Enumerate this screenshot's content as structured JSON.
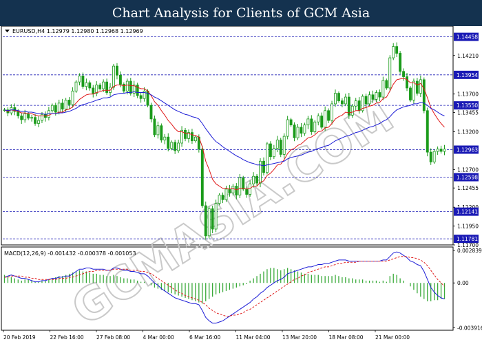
{
  "banner": {
    "title": "Chart Analysis for Clients of GCM Asia"
  },
  "watermark": "GCMASIA.COM",
  "colors": {
    "banner_bg": "#14324f",
    "candle": "#1a9b1a",
    "ma_fast": "#e01919",
    "ma_slow": "#1c1cd6",
    "level_line": "#1a1ab5",
    "level_box": "#1a1ab5",
    "macd_hist": "#3aaa3a",
    "macd_signal": "#e02020",
    "macd_line": "#1c1cd6"
  },
  "chart_data": [
    {
      "type": "candlestick",
      "header": "EURUSD,H4  1.12979 1.12980 1.12968 1.12969",
      "ylim": [
        1.117,
        1.146
      ],
      "yticks": [
        "1.14458",
        "1.14210",
        "1.13954",
        "1.13700",
        "1.13550",
        "1.13455",
        "1.13200",
        "1.12963",
        "1.12700",
        "1.12598",
        "1.12455",
        "1.12200",
        "1.12141",
        "1.11950",
        "1.11781",
        "1.11700"
      ],
      "levels": [
        {
          "value": 1.14458,
          "label": "1.14458"
        },
        {
          "value": 1.13954,
          "label": "1.13954"
        },
        {
          "value": 1.1355,
          "label": "1.13550"
        },
        {
          "value": 1.12963,
          "label": "1.12963"
        },
        {
          "value": 1.12598,
          "label": "1.12598"
        },
        {
          "value": 1.12141,
          "label": "1.12141"
        },
        {
          "value": 1.11781,
          "label": "1.11781"
        }
      ],
      "xticks": [
        "20 Feb 2019",
        "22 Feb 16:00",
        "27 Feb 08:00",
        "4 Mar 00:00",
        "6 Mar 16:00",
        "11 Mar 04:00",
        "13 Mar 20:00",
        "18 Mar 08:00",
        "21 Mar 00:00"
      ],
      "close": [
        1.1349,
        1.1345,
        1.1352,
        1.1347,
        1.1341,
        1.1336,
        1.1344,
        1.1338,
        1.1339,
        1.1331,
        1.1335,
        1.1343,
        1.1339,
        1.1348,
        1.1355,
        1.1346,
        1.1358,
        1.135,
        1.1362,
        1.1356,
        1.1374,
        1.1386,
        1.1394,
        1.138,
        1.1385,
        1.1378,
        1.1371,
        1.1382,
        1.1377,
        1.1386,
        1.1372,
        1.1379,
        1.1407,
        1.1395,
        1.1383,
        1.1374,
        1.1387,
        1.1371,
        1.1382,
        1.1368,
        1.1364,
        1.1374,
        1.1355,
        1.1337,
        1.1316,
        1.1328,
        1.1309,
        1.1313,
        1.1298,
        1.1306,
        1.1295,
        1.1305,
        1.1322,
        1.1311,
        1.1319,
        1.1308,
        1.1313,
        1.1297,
        1.1222,
        1.1182,
        1.1218,
        1.1191,
        1.1225,
        1.1236,
        1.123,
        1.1244,
        1.1239,
        1.1248,
        1.1236,
        1.1259,
        1.1244,
        1.1237,
        1.1251,
        1.1261,
        1.1252,
        1.1281,
        1.1266,
        1.1304,
        1.1287,
        1.1298,
        1.1309,
        1.129,
        1.1314,
        1.1336,
        1.1329,
        1.1312,
        1.1326,
        1.1318,
        1.1329,
        1.1337,
        1.132,
        1.1333,
        1.1341,
        1.1326,
        1.1348,
        1.1335,
        1.1357,
        1.1371,
        1.1361,
        1.1357,
        1.1366,
        1.1342,
        1.1354,
        1.1361,
        1.1348,
        1.1367,
        1.1357,
        1.1369,
        1.1363,
        1.1372,
        1.1366,
        1.1388,
        1.1378,
        1.1418,
        1.1433,
        1.1424,
        1.14,
        1.1393,
        1.1378,
        1.1362,
        1.1387,
        1.1371,
        1.1389,
        1.1348,
        1.1293,
        1.128,
        1.1294,
        1.1297,
        1.1294,
        1.1297
      ],
      "ma_fast": [
        1.1349,
        1.1347,
        1.1349,
        1.1348,
        1.1347,
        1.1345,
        1.1345,
        1.1344,
        1.1344,
        1.1342,
        1.1341,
        1.1341,
        1.1341,
        1.1342,
        1.1344,
        1.1344,
        1.1346,
        1.1346,
        1.1349,
        1.135,
        1.1353,
        1.1358,
        1.1363,
        1.1366,
        1.1369,
        1.137,
        1.137,
        1.1372,
        1.1373,
        1.1375,
        1.1375,
        1.1375,
        1.138,
        1.1382,
        1.1382,
        1.1381,
        1.1382,
        1.1381,
        1.1381,
        1.1379,
        1.1377,
        1.1377,
        1.1374,
        1.1368,
        1.136,
        1.1355,
        1.1348,
        1.1342,
        1.1335,
        1.133,
        1.1324,
        1.132,
        1.132,
        1.1318,
        1.1318,
        1.1316,
        1.1315,
        1.1313,
        1.13,
        1.1281,
        1.127,
        1.1257,
        1.1251,
        1.1248,
        1.1245,
        1.1245,
        1.1244,
        1.1245,
        1.1243,
        1.1245,
        1.1245,
        1.1244,
        1.1245,
        1.1248,
        1.1248,
        1.1253,
        1.1255,
        1.1262,
        1.1265,
        1.127,
        1.1276,
        1.1277,
        1.1283,
        1.1291,
        1.1296,
        1.1298,
        1.1302,
        1.1304,
        1.1308,
        1.1312,
        1.1313,
        1.1316,
        1.132,
        1.1321,
        1.1325,
        1.1326,
        1.1331,
        1.1337,
        1.134,
        1.1342,
        1.1346,
        1.1345,
        1.1346,
        1.1348,
        1.1348,
        1.1351,
        1.1352,
        1.1354,
        1.1355,
        1.1358,
        1.1359,
        1.1364,
        1.1366,
        1.1374,
        1.1383,
        1.1389,
        1.139,
        1.1391,
        1.1389,
        1.1385,
        1.1385,
        1.1382,
        1.1384,
        1.1377,
        1.1365,
        1.1352,
        1.1344,
        1.1337,
        1.1331,
        1.1326
      ],
      "ma_slow": [
        1.1349,
        1.1348,
        1.1349,
        1.1349,
        1.1348,
        1.1347,
        1.1347,
        1.1346,
        1.1346,
        1.1345,
        1.1344,
        1.1344,
        1.1343,
        1.1344,
        1.1344,
        1.1344,
        1.1345,
        1.1345,
        1.1346,
        1.1347,
        1.1349,
        1.1351,
        1.1354,
        1.1356,
        1.1357,
        1.1359,
        1.136,
        1.1362,
        1.1363,
        1.1365,
        1.1365,
        1.1366,
        1.1369,
        1.137,
        1.1371,
        1.1371,
        1.1372,
        1.1372,
        1.1373,
        1.1372,
        1.1372,
        1.1372,
        1.1371,
        1.1369,
        1.1366,
        1.1364,
        1.1361,
        1.1358,
        1.1355,
        1.1352,
        1.1349,
        1.1347,
        1.1345,
        1.1343,
        1.1342,
        1.134,
        1.1339,
        1.1337,
        1.1331,
        1.1324,
        1.1318,
        1.1312,
        1.1307,
        1.1304,
        1.13,
        1.1297,
        1.1294,
        1.1291,
        1.1288,
        1.1286,
        1.1283,
        1.1281,
        1.1279,
        1.1278,
        1.1276,
        1.1276,
        1.1275,
        1.1276,
        1.1277,
        1.1278,
        1.1279,
        1.128,
        1.1281,
        1.1284,
        1.1286,
        1.1287,
        1.1288,
        1.1289,
        1.1291,
        1.1293,
        1.1294,
        1.1296,
        1.1298,
        1.1299,
        1.1301,
        1.1302,
        1.1305,
        1.1308,
        1.131,
        1.1312,
        1.1314,
        1.1315,
        1.1317,
        1.1319,
        1.132,
        1.1322,
        1.1324,
        1.1326,
        1.1327,
        1.1329,
        1.1331,
        1.1334,
        1.1336,
        1.134,
        1.1345,
        1.1349,
        1.1351,
        1.1353,
        1.1354,
        1.1355,
        1.1357,
        1.1357,
        1.1359,
        1.1358,
        1.1355,
        1.1351,
        1.1349,
        1.1346,
        1.1343,
        1.1341
      ]
    },
    {
      "type": "macd",
      "header": "MACD(12,26,9) -0.001432 -0.000378 -0.001053",
      "ylim": [
        -0.004,
        0.00295
      ],
      "yticks": [
        "0.002839",
        "0.00",
        "-0.003916"
      ],
      "hist": [
        0.0007,
        0.0006,
        0.0005,
        0.0004,
        0.0003,
        0.0002,
        0.0003,
        0.0003,
        0.0002,
        0.0001,
        0.0001,
        0.0002,
        0.0002,
        0.0003,
        0.0004,
        0.0005,
        0.0006,
        0.0006,
        0.0007,
        0.0008,
        0.0009,
        0.001,
        0.0011,
        0.001,
        0.001,
        0.0009,
        0.0008,
        0.0008,
        0.0007,
        0.0007,
        0.0006,
        0.0006,
        0.0007,
        0.0006,
        0.0005,
        0.0004,
        0.0004,
        0.0003,
        0.0003,
        0.0002,
        0.0001,
        0.0001,
        0.0,
        -0.0002,
        -0.0004,
        -0.0005,
        -0.0006,
        -0.0007,
        -0.0008,
        -0.0009,
        -0.001,
        -0.0011,
        -0.0012,
        -0.0013,
        -0.0014,
        -0.0015,
        -0.0016,
        -0.0017,
        -0.0018,
        -0.0016,
        -0.0014,
        -0.0012,
        -0.001,
        -0.0009,
        -0.0008,
        -0.0007,
        -0.0006,
        -0.0005,
        -0.0004,
        -0.0003,
        -0.0002,
        -0.0001,
        0.0002,
        0.0004,
        0.0006,
        0.0008,
        0.001,
        0.0012,
        0.0013,
        0.0013,
        0.0012,
        0.0011,
        0.0012,
        0.0013,
        0.0012,
        0.0011,
        0.001,
        0.0009,
        0.0008,
        0.0008,
        0.0007,
        0.0007,
        0.0007,
        0.0006,
        0.0006,
        0.0006,
        0.0006,
        0.0007,
        0.0006,
        0.0005,
        0.0005,
        0.0004,
        0.0004,
        0.0003,
        0.0003,
        0.0003,
        0.0002,
        0.0002,
        0.0002,
        0.0002,
        0.0001,
        0.0002,
        0.0001,
        0.0006,
        0.0008,
        0.0007,
        0.0004,
        0.0002,
        0.0,
        -0.0003,
        -0.0006,
        -0.0009,
        -0.0012,
        -0.0014,
        -0.0016,
        -0.0016,
        -0.0015,
        -0.0015,
        -0.0014,
        -0.0014
      ],
      "macd_line": [
        0.0005,
        0.0006,
        0.0007,
        0.0006,
        0.0005,
        0.0004,
        0.0004,
        0.0003,
        0.0002,
        0.0001,
        0.0001,
        0.0002,
        0.0002,
        0.0003,
        0.0004,
        0.0004,
        0.0005,
        0.0005,
        0.0006,
        0.0006,
        0.0008,
        0.001,
        0.0012,
        0.0012,
        0.0013,
        0.0013,
        0.0012,
        0.0012,
        0.0012,
        0.0012,
        0.0011,
        0.0011,
        0.0013,
        0.0013,
        0.0012,
        0.0011,
        0.0011,
        0.001,
        0.001,
        0.0009,
        0.0008,
        0.0008,
        0.0006,
        0.0003,
        0.0,
        -0.0002,
        -0.0005,
        -0.0007,
        -0.0009,
        -0.0011,
        -0.0013,
        -0.0014,
        -0.0015,
        -0.0016,
        -0.0017,
        -0.0018,
        -0.0018,
        -0.0019,
        -0.0024,
        -0.003,
        -0.0033,
        -0.0035,
        -0.0035,
        -0.0034,
        -0.0033,
        -0.0031,
        -0.0029,
        -0.0027,
        -0.0025,
        -0.0023,
        -0.0021,
        -0.0019,
        -0.0017,
        -0.0014,
        -0.0012,
        -0.0009,
        -0.0007,
        -0.0004,
        -0.0002,
        0.0,
        0.0002,
        0.0003,
        0.0005,
        0.0008,
        0.0009,
        0.001,
        0.0011,
        0.0012,
        0.0013,
        0.0014,
        0.0014,
        0.0015,
        0.0016,
        0.0016,
        0.0017,
        0.0017,
        0.0018,
        0.0019,
        0.002,
        0.002,
        0.002,
        0.0019,
        0.0019,
        0.0019,
        0.0019,
        0.0019,
        0.0019,
        0.0019,
        0.0019,
        0.0019,
        0.0019,
        0.002,
        0.002,
        0.0023,
        0.0026,
        0.0027,
        0.0026,
        0.0024,
        0.0022,
        0.0019,
        0.0018,
        0.0016,
        0.0015,
        0.001,
        0.0003,
        -0.0004,
        -0.0008,
        -0.0011,
        -0.0013,
        -0.0014
      ],
      "signal": [
        0.0005,
        0.0005,
        0.0006,
        0.0006,
        0.0006,
        0.0006,
        0.0005,
        0.0005,
        0.0004,
        0.0004,
        0.0003,
        0.0003,
        0.0003,
        0.0003,
        0.0003,
        0.0003,
        0.0004,
        0.0004,
        0.0004,
        0.0005,
        0.0005,
        0.0006,
        0.0007,
        0.0008,
        0.0009,
        0.001,
        0.001,
        0.0011,
        0.0011,
        0.0011,
        0.0011,
        0.0011,
        0.0012,
        0.0012,
        0.0012,
        0.0012,
        0.0012,
        0.0011,
        0.0011,
        0.0011,
        0.001,
        0.001,
        0.0009,
        0.0008,
        0.0006,
        0.0004,
        0.0002,
        0.0,
        -0.0002,
        -0.0004,
        -0.0006,
        -0.0008,
        -0.0009,
        -0.0011,
        -0.0012,
        -0.0013,
        -0.0014,
        -0.0015,
        -0.0017,
        -0.0019,
        -0.0022,
        -0.0024,
        -0.0026,
        -0.0027,
        -0.0028,
        -0.0029,
        -0.0029,
        -0.0028,
        -0.0028,
        -0.0027,
        -0.0026,
        -0.0024,
        -0.0023,
        -0.0021,
        -0.0019,
        -0.0017,
        -0.0015,
        -0.0013,
        -0.0011,
        -0.0009,
        -0.0007,
        -0.0005,
        -0.0003,
        -0.0001,
        0.0001,
        0.0003,
        0.0004,
        0.0006,
        0.0007,
        0.0009,
        0.001,
        0.0011,
        0.0012,
        0.0013,
        0.0014,
        0.0014,
        0.0015,
        0.0016,
        0.0017,
        0.0017,
        0.0018,
        0.0018,
        0.0018,
        0.0018,
        0.0019,
        0.0019,
        0.0019,
        0.0019,
        0.0019,
        0.0019,
        0.0019,
        0.0019,
        0.0019,
        0.002,
        0.0021,
        0.0022,
        0.0023,
        0.0023,
        0.0023,
        0.0022,
        0.0022,
        0.0021,
        0.002,
        0.0018,
        0.0015,
        0.0011,
        0.0007,
        0.0003,
        0.0,
        -0.0003
      ]
    }
  ]
}
